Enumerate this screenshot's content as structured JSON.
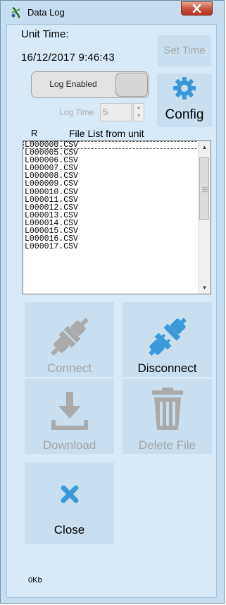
{
  "window": {
    "title": "Data Log"
  },
  "unit_time": {
    "label": "Unit Time:",
    "value": "16/12/2017  9:46:43"
  },
  "set_time_button": {
    "label": "Set Time",
    "enabled": false
  },
  "log_toggle": {
    "label": "Log Enabled"
  },
  "log_time": {
    "label": "Log Time",
    "value": "5",
    "enabled": false
  },
  "config_button": {
    "label": "Config",
    "icon": "gear-icon"
  },
  "file_list": {
    "refresh_label": "R",
    "title": "File List from unit",
    "items": [
      "L000000.CSV",
      "L000005.CSV",
      "L000006.CSV",
      "L000007.CSV",
      "L000008.CSV",
      "L000009.CSV",
      "L000010.CSV",
      "L000011.CSV",
      "L000012.CSV",
      "L000013.CSV",
      "L000014.CSV",
      "L000015.CSV",
      "L000016.CSV",
      "L000017.CSV"
    ],
    "selected_index": 0
  },
  "buttons": {
    "connect": {
      "label": "Connect",
      "enabled": false,
      "icon": "plug-connected-icon"
    },
    "disconnect": {
      "label": "Disconnect",
      "enabled": true,
      "icon": "plug-disconnected-icon"
    },
    "download": {
      "label": "Download",
      "enabled": false,
      "icon": "download-icon"
    },
    "delete_file": {
      "label": "Delete File",
      "enabled": false,
      "icon": "trash-icon"
    },
    "close": {
      "label": "Close",
      "enabled": true,
      "icon": "close-x-icon"
    }
  },
  "status": {
    "size": "0Kb"
  },
  "colors": {
    "accent_blue": "#3a9ad9",
    "disabled_gray": "#a3a3a3",
    "panel": "#d8e9f7",
    "tile": "#c9dff0"
  }
}
